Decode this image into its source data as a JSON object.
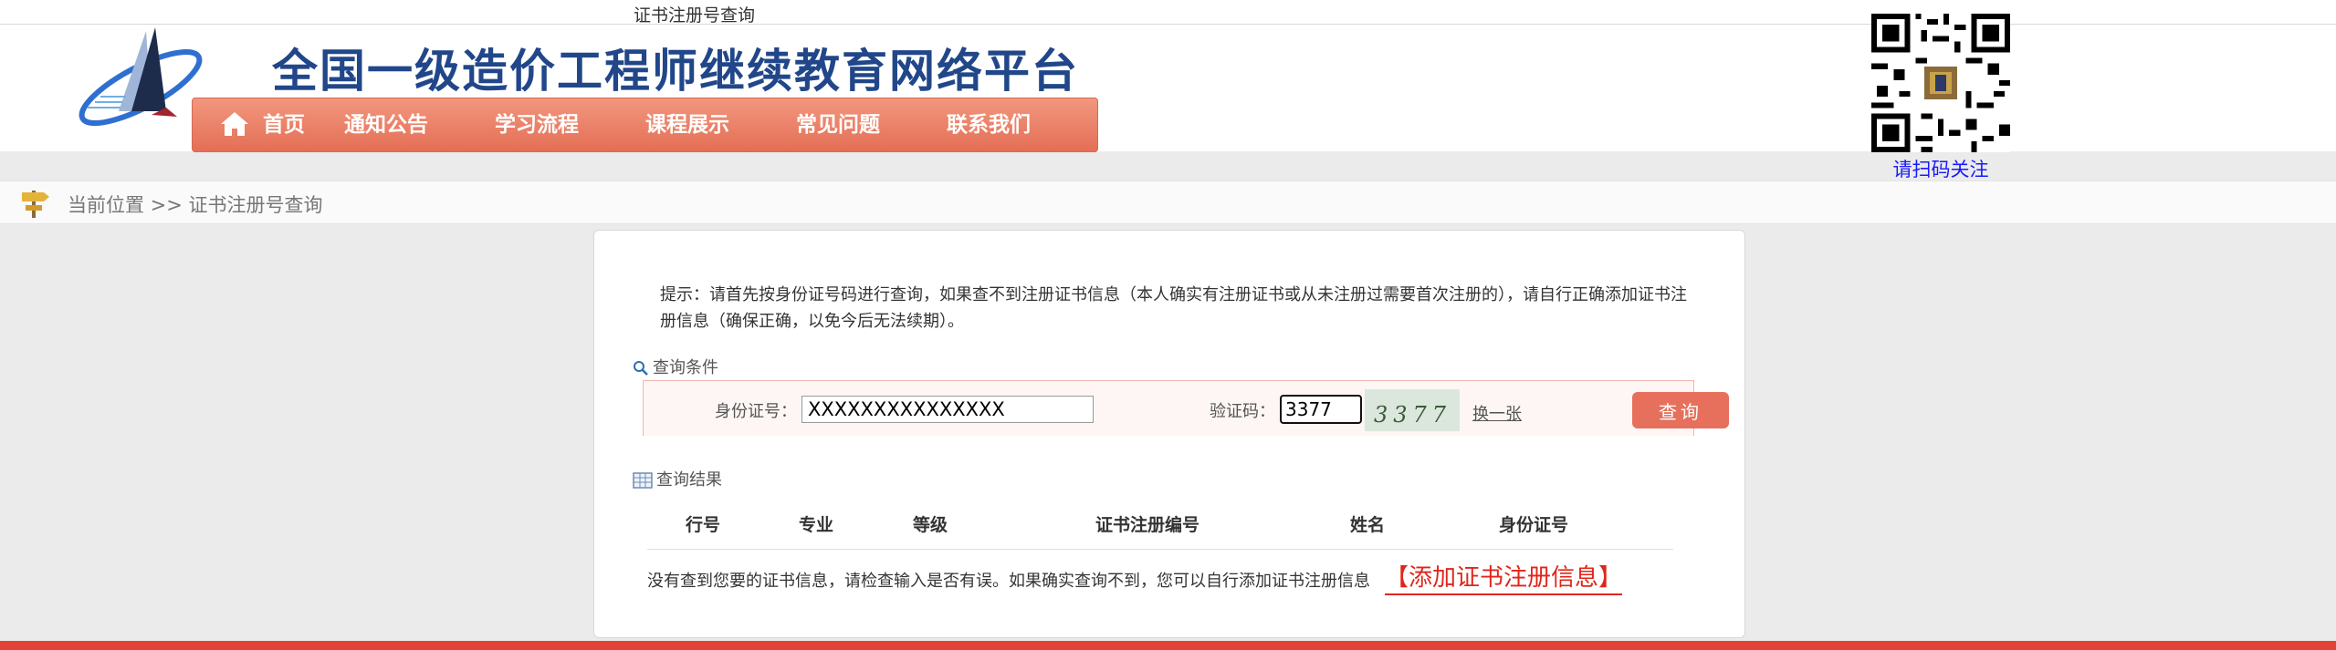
{
  "browser": {
    "tab_title": "证书注册号查询"
  },
  "header": {
    "site_title": "全国一级造价工程师继续教育网络平台",
    "qr_caption": "请扫码关注"
  },
  "nav": {
    "items": [
      {
        "label": "首页",
        "icon": "home-icon"
      },
      {
        "label": "通知公告"
      },
      {
        "label": "学习流程"
      },
      {
        "label": "课程展示"
      },
      {
        "label": "常见问题"
      },
      {
        "label": "联系我们"
      }
    ]
  },
  "breadcrumb": {
    "text": "当前位置 >> 证书注册号查询"
  },
  "notice": {
    "text": "提示：请首先按身份证号码进行查询，如果查不到注册证书信息（本人确实有注册证书或从未注册过需要首次注册的），请自行正确添加证书注册信息（确保正确，以免今后无法续期）。"
  },
  "query": {
    "heading": "查询条件",
    "id_label": "身份证号：",
    "id_value": "XXXXXXXXXXXXXXX",
    "captcha_label": "验证码：",
    "captcha_value": "3377",
    "captcha_image_text": "3377",
    "refresh_label": "换一张",
    "submit_label": "查询"
  },
  "results": {
    "heading": "查询结果",
    "columns": [
      "行号",
      "专业",
      "等级",
      "证书注册编号",
      "姓名",
      "身份证号"
    ],
    "empty_message": "没有查到您要的证书信息，请检查输入是否有误。如果确实查询不到，您可以自行添加证书注册信息",
    "add_link": "【添加证书注册信息】"
  },
  "colors": {
    "title_blue": "#21478a",
    "nav_orange": "#e36f55",
    "button_orange": "#e6705c",
    "link_red": "#e0261b",
    "footer_red": "#e34236",
    "qr_caption_blue": "#1a1aff"
  }
}
